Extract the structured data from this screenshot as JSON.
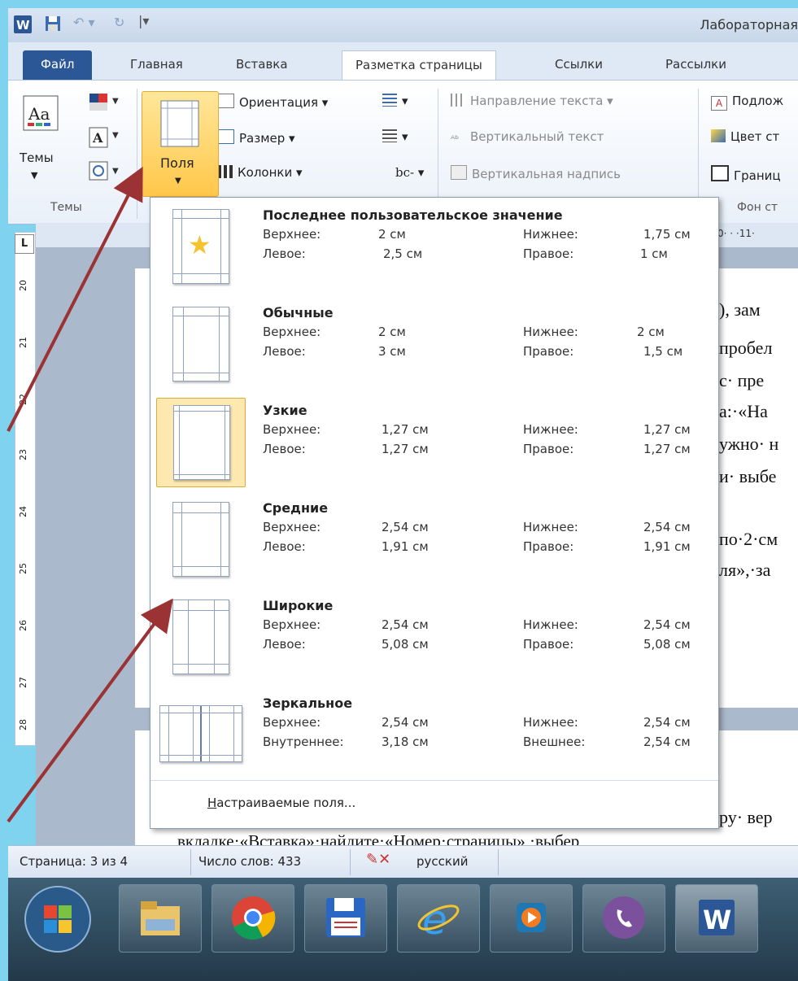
{
  "window": {
    "title": "Лабораторная"
  },
  "tabs": [
    {
      "label": "Файл"
    },
    {
      "label": "Главная"
    },
    {
      "label": "Вставка"
    },
    {
      "label": "Разметка страницы"
    },
    {
      "label": "Ссылки"
    },
    {
      "label": "Рассылки"
    }
  ],
  "ribbon": {
    "themes_label": "Темы",
    "themes_group_label": "Темы",
    "fields_label": "Поля",
    "orientation_label": "Ориентация",
    "size_label": "Размер",
    "columns_label": "Колонки",
    "text_direction_label": "Направление текста",
    "vertical_text_label": "Вертикальный текст",
    "vertical_caption_label": "Вертикальная надпись",
    "watermark_label": "Подлож",
    "page_color_label": "Цвет ст",
    "page_borders_label": "Границ",
    "page_bg_group_label": "Фон ст"
  },
  "dropdown": {
    "items": [
      {
        "name": "Последнее пользовательское значение",
        "k1": "Верхнее:",
        "v1": "2 см",
        "k2": "Нижнее:",
        "v2": "1,75 см",
        "k3": "Левое:",
        "v3": "2,5 см",
        "k4": "Правое:",
        "v4": "1 см"
      },
      {
        "name": "Обычные",
        "k1": "Верхнее:",
        "v1": "2 см",
        "k2": "Нижнее:",
        "v2": "2 см",
        "k3": "Левое:",
        "v3": "3 см",
        "k4": "Правое:",
        "v4": "1,5 см"
      },
      {
        "name": "Узкие",
        "k1": "Верхнее:",
        "v1": "1,27 см",
        "k2": "Нижнее:",
        "v2": "1,27 см",
        "k3": "Левое:",
        "v3": "1,27 см",
        "k4": "Правое:",
        "v4": "1,27 см"
      },
      {
        "name": "Средние",
        "k1": "Верхнее:",
        "v1": "2,54 см",
        "k2": "Нижнее:",
        "v2": "2,54 см",
        "k3": "Левое:",
        "v3": "1,91 см",
        "k4": "Правое:",
        "v4": "1,91 см"
      },
      {
        "name": "Широкие",
        "k1": "Верхнее:",
        "v1": "2,54 см",
        "k2": "Нижнее:",
        "v2": "2,54 см",
        "k3": "Левое:",
        "v3": "5,08 см",
        "k4": "Правое:",
        "v4": "5,08 см"
      },
      {
        "name": "Зеркальное",
        "k1": "Верхнее:",
        "v1": "2,54 см",
        "k2": "Нижнее:",
        "v2": "2,54 см",
        "k3": "Внутреннее:",
        "v3": "3,18 см",
        "k4": "Внешнее:",
        "v4": "2,54 см"
      }
    ],
    "selected_index": 2,
    "custom_label": "Настраиваемые поля..."
  },
  "document": {
    "lines": [
      "), зам",
      "пробел",
      "с· пре",
      "а:·«На",
      "ужно· н",
      "и· выбе",
      "по·2·см",
      "ля»,·за",
      "ру· вер",
      "вкладке·«Вставка»·найдите·«Номер·страницы»,·выбер"
    ]
  },
  "vertical_ruler": {
    "numbers": [
      "20",
      "21",
      "22",
      "23",
      "24",
      "25",
      "26",
      "27",
      "28"
    ]
  },
  "horizontal_ruler": {
    "text": "0· · ·11·"
  },
  "status": {
    "page": "Страница: 3 из 4",
    "words": "Число слов: 433",
    "language": "русский"
  },
  "colors": {
    "background": "#7fd3ee",
    "arrow": "#9b3233",
    "highlight": "#ffc74a",
    "file_tab": "#2b5797"
  }
}
